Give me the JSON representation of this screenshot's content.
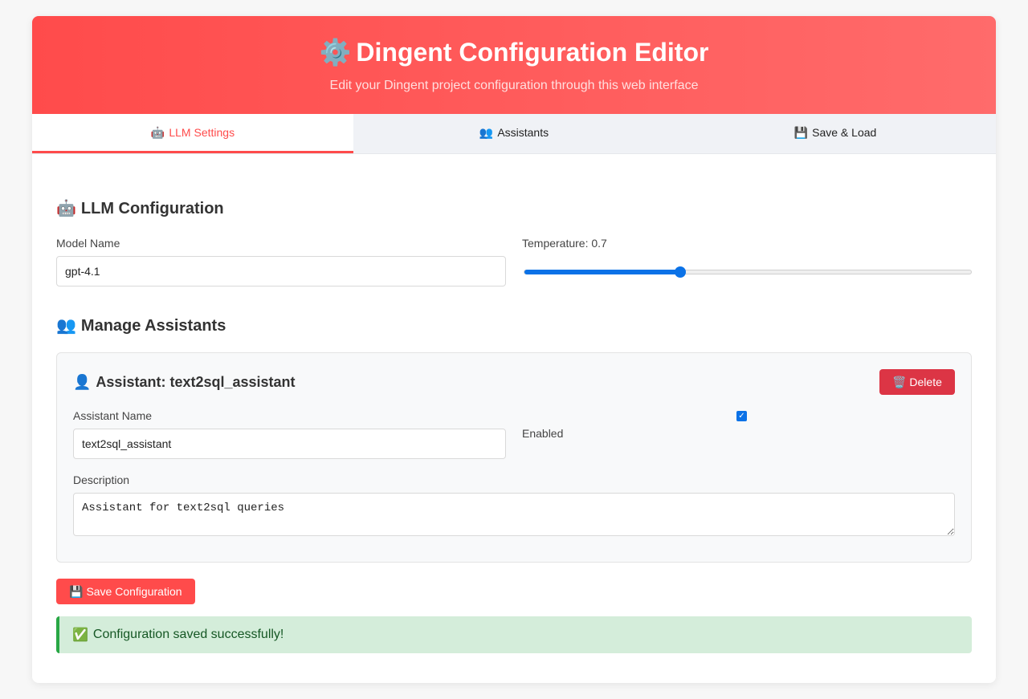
{
  "header": {
    "icon": "⚙️",
    "title": "Dingent Configuration Editor",
    "subtitle": "Edit your Dingent project configuration through this web interface"
  },
  "tabs": [
    {
      "icon": "🤖",
      "label": "LLM Settings",
      "active": true
    },
    {
      "icon": "👥",
      "label": "Assistants",
      "active": false
    },
    {
      "icon": "💾",
      "label": "Save & Load",
      "active": false
    }
  ],
  "llm": {
    "section_icon": "🤖",
    "section_title": "LLM Configuration",
    "model_label": "Model Name",
    "model_value": "gpt-4.1",
    "temperature_label": "Temperature: 0.7",
    "temperature_value": 0.7,
    "temperature_min": 0,
    "temperature_max": 2
  },
  "assistants": {
    "section_icon": "👥",
    "section_title": "Manage Assistants",
    "items": [
      {
        "title_icon": "👤",
        "title": "Assistant: text2sql_assistant",
        "delete_label": "🗑️ Delete",
        "name_label": "Assistant Name",
        "name_value": "text2sql_assistant",
        "enabled_label": "Enabled",
        "enabled": true,
        "description_label": "Description",
        "description_value": "Assistant for text2sql queries"
      }
    ]
  },
  "actions": {
    "save_icon": "💾",
    "save_label": "Save Configuration"
  },
  "status": {
    "icon": "✅",
    "message": "Configuration saved successfully!"
  },
  "colors": {
    "brand": "#ff4b4b",
    "delete": "#dc3545",
    "slider": "#0b72e7",
    "success_bg": "#d4edda",
    "success_text": "#155724"
  }
}
